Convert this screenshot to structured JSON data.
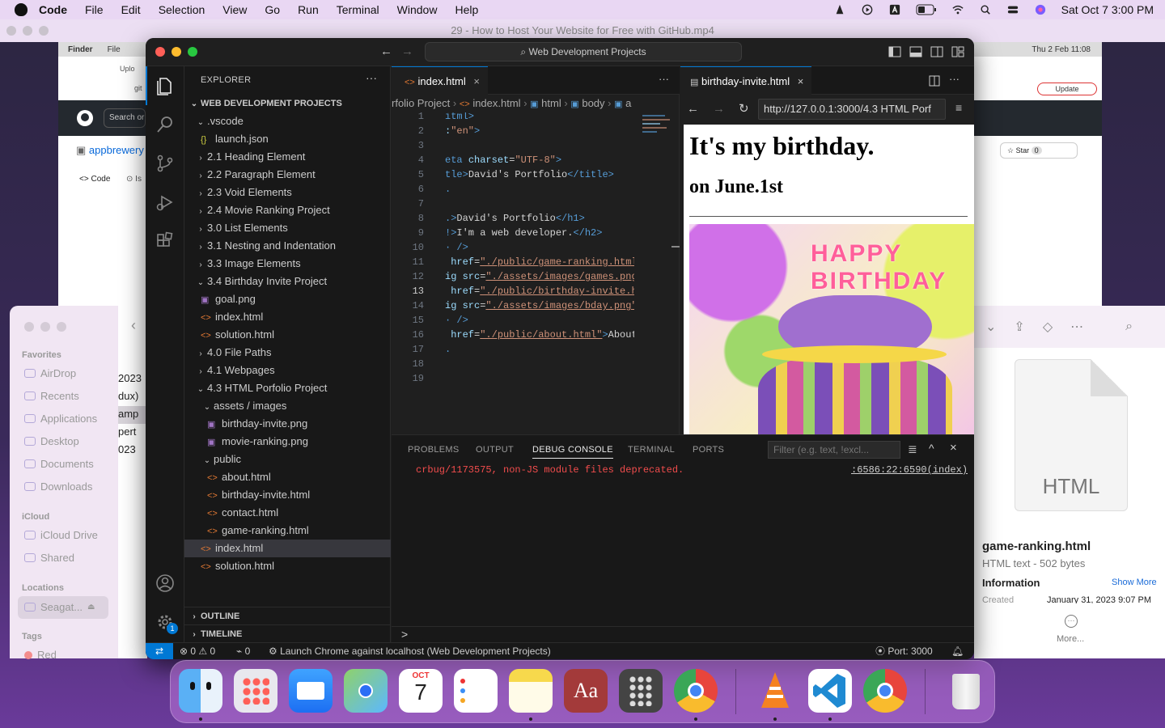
{
  "menubar": {
    "app": "Code",
    "items": [
      "File",
      "Edit",
      "Selection",
      "View",
      "Go",
      "Run",
      "Terminal",
      "Window",
      "Help"
    ],
    "datetime": "Sat Oct 7  3:00 PM"
  },
  "video_title": "29 - How to Host Your Website for Free with GitHub.mp4",
  "bg_browser": {
    "finder_label": "Finder",
    "file_label": "File",
    "clock": "Thu 2 Feb  11:08",
    "search": "Search or",
    "repo": "appbrewery",
    "code_tab": "Code",
    "issues_tab": "Is",
    "update": "Update",
    "star": "Star",
    "star_count": "0",
    "upload_tab": "Uplo",
    "git": "git"
  },
  "finder": {
    "favorites_heading": "Favorites",
    "favorites": [
      "AirDrop",
      "Recents",
      "Applications",
      "Desktop",
      "Documents",
      "Downloads"
    ],
    "icloud_heading": "iCloud",
    "icloud": [
      "iCloud Drive",
      "Shared"
    ],
    "locations_heading": "Locations",
    "locations": [
      "Seagat..."
    ],
    "tags_heading": "Tags",
    "tags": [
      "Red"
    ],
    "partial": [
      "2023",
      "dux)",
      "amp",
      "pert",
      "023"
    ]
  },
  "preview": {
    "doc_label": "HTML",
    "filename": "game-ranking.html",
    "filetype": "HTML text - 502 bytes",
    "info_heading": "Information",
    "show_more": "Show More",
    "created_label": "Created",
    "created_value": "January 31, 2023 9:07 PM",
    "more": "More..."
  },
  "vscode": {
    "command_center": "Web Development Projects",
    "explorer_title": "EXPLORER",
    "root": "WEB DEVELOPMENT PROJECTS",
    "tree": [
      {
        "label": ".vscode",
        "type": "folder-open",
        "depth": 1
      },
      {
        "label": "launch.json",
        "type": "json",
        "depth": 2
      },
      {
        "label": "2.1 Heading Element",
        "type": "folder",
        "depth": 1
      },
      {
        "label": "2.2 Paragraph Element",
        "type": "folder",
        "depth": 1
      },
      {
        "label": "2.3 Void Elements",
        "type": "folder",
        "depth": 1
      },
      {
        "label": "2.4 Movie Ranking Project",
        "type": "folder",
        "depth": 1
      },
      {
        "label": "3.0 List Elements",
        "type": "folder",
        "depth": 1
      },
      {
        "label": "3.1 Nesting and Indentation",
        "type": "folder",
        "depth": 1
      },
      {
        "label": "3.3 Image Elements",
        "type": "folder",
        "depth": 1
      },
      {
        "label": "3.4 Birthday Invite Project",
        "type": "folder-open",
        "depth": 1
      },
      {
        "label": "goal.png",
        "type": "png",
        "depth": 2
      },
      {
        "label": "index.html",
        "type": "html",
        "depth": 2
      },
      {
        "label": "solution.html",
        "type": "html",
        "depth": 2
      },
      {
        "label": "4.0 File Paths",
        "type": "folder",
        "depth": 1
      },
      {
        "label": "4.1 Webpages",
        "type": "folder",
        "depth": 1
      },
      {
        "label": "4.3 HTML Porfolio Project",
        "type": "folder-open",
        "depth": 1
      },
      {
        "label": "assets / images",
        "type": "folder-open",
        "depth": 2
      },
      {
        "label": "birthday-invite.png",
        "type": "png",
        "depth": 3
      },
      {
        "label": "movie-ranking.png",
        "type": "png",
        "depth": 3
      },
      {
        "label": "public",
        "type": "folder-open",
        "depth": 2
      },
      {
        "label": "about.html",
        "type": "html",
        "depth": 3
      },
      {
        "label": "birthday-invite.html",
        "type": "html",
        "depth": 3
      },
      {
        "label": "contact.html",
        "type": "html",
        "depth": 3
      },
      {
        "label": "game-ranking.html",
        "type": "html",
        "depth": 3
      },
      {
        "label": "index.html",
        "type": "html",
        "depth": 2,
        "selected": true
      },
      {
        "label": "solution.html",
        "type": "html",
        "depth": 2
      }
    ],
    "outline": "OUTLINE",
    "timeline": "TIMELINE",
    "editor_tab": "index.html",
    "breadcrumbs": [
      "rfolio Project",
      "index.html",
      "html",
      "body",
      "a"
    ],
    "active_line": "13",
    "code_lines": [
      {
        "n": "1",
        "parts": [
          [
            "tag",
            "itml>"
          ]
        ]
      },
      {
        "n": "2",
        "parts": [
          [
            "attr",
            ":"
          ],
          [
            "str",
            "\"en\""
          ],
          [
            "tag",
            ">"
          ]
        ]
      },
      {
        "n": "3",
        "parts": []
      },
      {
        "n": "4",
        "parts": [
          [
            "tag",
            "eta "
          ],
          [
            "attr",
            "charset"
          ],
          [
            "txt",
            "="
          ],
          [
            "str",
            "\"UTF-8\""
          ],
          [
            "tag",
            ">"
          ]
        ]
      },
      {
        "n": "5",
        "parts": [
          [
            "tag",
            "tle>"
          ],
          [
            "txt",
            "David's Portfolio"
          ],
          [
            "tag",
            "</title>"
          ]
        ]
      },
      {
        "n": "6",
        "parts": [
          [
            "tag",
            "."
          ]
        ]
      },
      {
        "n": "7",
        "parts": []
      },
      {
        "n": "8",
        "parts": [
          [
            "tag",
            ".>"
          ],
          [
            "txt",
            "David's Portfolio"
          ],
          [
            "tag",
            "</h1>"
          ]
        ]
      },
      {
        "n": "9",
        "parts": [
          [
            "tag",
            "!>"
          ],
          [
            "txt",
            "I'm a web developer."
          ],
          [
            "tag",
            "</h2>"
          ]
        ]
      },
      {
        "n": "10",
        "parts": [
          [
            "tag",
            "· />"
          ]
        ]
      },
      {
        "n": "11",
        "parts": [
          [
            "attr",
            " href"
          ],
          [
            "txt",
            "="
          ],
          [
            "str",
            "\"./public/game-ranking.html\""
          ]
        ]
      },
      {
        "n": "12",
        "parts": [
          [
            "attr",
            "ig src"
          ],
          [
            "txt",
            "="
          ],
          [
            "str",
            "\"./assets/images/games.png\""
          ]
        ]
      },
      {
        "n": "13",
        "parts": [
          [
            "attr",
            " href"
          ],
          [
            "txt",
            "="
          ],
          [
            "str",
            "\"./public/birthday-invite.ht"
          ]
        ]
      },
      {
        "n": "14",
        "parts": [
          [
            "attr",
            "ig src"
          ],
          [
            "txt",
            "="
          ],
          [
            "str",
            "\"./assets/images/bday.png\""
          ]
        ]
      },
      {
        "n": "15",
        "parts": [
          [
            "tag",
            "· />"
          ]
        ]
      },
      {
        "n": "16",
        "parts": [
          [
            "attr",
            " href"
          ],
          [
            "txt",
            "="
          ],
          [
            "str",
            "\"./public/about.html\""
          ],
          [
            "tag",
            ">"
          ],
          [
            "txt",
            "About"
          ]
        ]
      },
      {
        "n": "17",
        "parts": [
          [
            "tag",
            "."
          ]
        ]
      },
      {
        "n": "18",
        "parts": []
      },
      {
        "n": "19",
        "parts": []
      }
    ],
    "browser_tab": "birthday-invite.html",
    "url": "http://127.0.0.1:3000/4.3 HTML Porf",
    "page_h1": "It's my birthday.",
    "page_h2": "on June.1st",
    "cake_text": "HAPPY BIRTHDAY",
    "panel_tabs": [
      "PROBLEMS",
      "OUTPUT",
      "DEBUG CONSOLE",
      "TERMINAL",
      "PORTS"
    ],
    "active_panel_tab": "DEBUG CONSOLE",
    "filter_placeholder": "Filter (e.g. text, !excl...",
    "console_message": "crbug/1173575, non-JS module files deprecated.",
    "console_source": ":6586:22:6590(index)",
    "prompt": ">",
    "status": {
      "errors": "0",
      "warnings": "0",
      "ports": "0",
      "launch": "Launch Chrome against localhost (Web Development Projects)",
      "port": "Port: 3000"
    },
    "settings_badge": "1"
  },
  "dock": {
    "calendar_month": "OCT",
    "calendar_day": "7",
    "dictionary_label": "Aa",
    "apps": [
      "Finder",
      "Launchpad",
      "Mail",
      "Maps",
      "Calendar",
      "Reminders",
      "Notes",
      "Dictionary",
      "Calculator",
      "Chrome Dev",
      "VLC",
      "Visual Studio Code",
      "Chrome Dev",
      "Trash"
    ]
  },
  "colors": {
    "vscode_accent": "#0078d4",
    "tag": "#569cd6",
    "attr": "#9cdcfe",
    "string": "#ce9178",
    "error_text": "#f14c4c"
  }
}
